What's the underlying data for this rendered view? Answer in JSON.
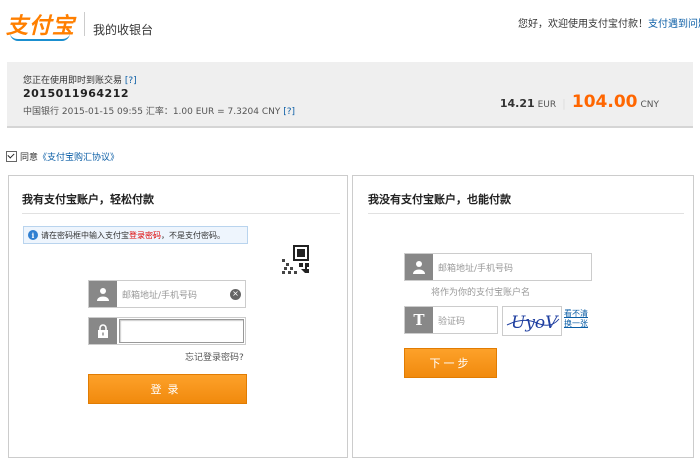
{
  "header": {
    "logo_text": "支付宝",
    "cashier_title": "我的收银台",
    "greeting": "您好，欢迎使用支付宝付款！",
    "help_link": "支付遇到问题?"
  },
  "order": {
    "label": "您正在使用即时到账交易",
    "label_help": "[?]",
    "number": "2015011964212",
    "rate_text": "中国银行 2015-01-15 09:55 汇率：1.00 EUR = 7.3204 CNY",
    "rate_help": "[?]",
    "amount_foreign": "14.21",
    "currency_foreign": "EUR",
    "separator": "|",
    "amount_cny": "104.00",
    "currency_cny": "CNY"
  },
  "agreement": {
    "prefix": "同意",
    "link": "《支付宝购汇协议》",
    "checked": true
  },
  "left_panel": {
    "title": "我有支付宝账户，轻松付款",
    "tip_icon": "i",
    "tip_before": "请在密码框中输入支付宝",
    "tip_highlight": "登录密码",
    "tip_after": "，不是支付密码。",
    "account_placeholder": "邮箱地址/手机号码",
    "clear_glyph": "×",
    "forgot_link": "忘记登录密码?",
    "login_button": "登录"
  },
  "right_panel": {
    "title": "我没有支付宝账户，也能付款",
    "account_placeholder": "邮箱地址/手机号码",
    "account_hint": "将作为你的支付宝账户名",
    "captcha_icon_glyph": "T",
    "captcha_placeholder": "验证码",
    "captcha_text": "UyoV",
    "captcha_refresh": "看不清换一张",
    "next_button": "下一步"
  },
  "colors": {
    "brand_orange": "#ff6600",
    "button_orange": "#f18a0d",
    "link_blue": "#0b5ea6",
    "icon_gray": "#888888"
  },
  "icons": {
    "user": "user-icon",
    "lock": "lock-icon",
    "qr": "qr-code-icon",
    "captcha": "text-icon"
  }
}
